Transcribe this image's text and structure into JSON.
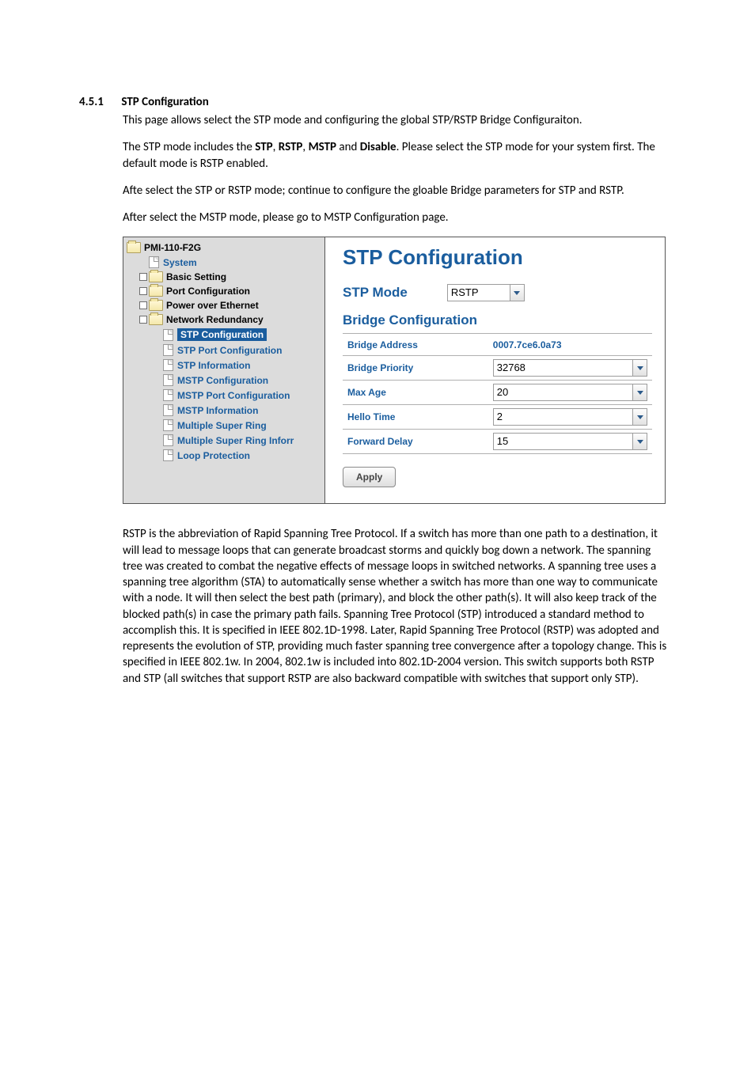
{
  "section": {
    "number": "4.5.1",
    "title": "STP Configuration"
  },
  "paragraphs": {
    "p1": "This page allows select the STP mode and configuring the global STP/RSTP Bridge Configuraiton.",
    "p2a": "The STP mode includes the ",
    "p2b": ", ",
    "p2c": ", ",
    "p2d": " and ",
    "p2e": ". Please select the STP mode for your system first. The default mode is RSTP enabled.",
    "p2_bold1": "STP",
    "p2_bold2": "RSTP",
    "p2_bold3": "MSTP",
    "p2_bold4": "Disable",
    "p3": "Afte select the STP or RSTP mode; continue to configure the gloable Bridge parameters for STP and RSTP.",
    "p4": "After select the MSTP mode, please go to MSTP Configuration page.",
    "p5": "RSTP is the abbreviation of Rapid Spanning Tree Protocol. If a switch has more than one path to a destination, it will lead to message loops that can generate broadcast storms and quickly bog down a network. The spanning tree was created to combat the negative effects of message loops in switched networks. A spanning tree uses a spanning tree algorithm (STA) to automatically sense whether a switch has more than one way to communicate with a node. It will then select the best path (primary), and block the other path(s). It will also keep track of the blocked path(s) in case the primary path fails. Spanning Tree Protocol (STP) introduced a standard method to accomplish this. It is specified in IEEE 802.1D-1998. Later, Rapid Spanning Tree Protocol (RSTP) was adopted and represents the evolution of STP, providing much faster spanning tree convergence after a topology change. This is specified in IEEE 802.1w. In 2004, 802.1w is included into 802.1D-2004 version. This switch supports both RSTP and STP (all switches that support RSTP are also backward compatible with switches that support only STP)."
  },
  "tree": {
    "root": "PMI-110-F2G",
    "system": "System",
    "basic_setting": "Basic Setting",
    "port_config": "Port Configuration",
    "power_over_ethernet": "Power over Ethernet",
    "network_redundancy": "Network Redundancy",
    "stp_configuration": "STP Configuration",
    "stp_port_configuration": "STP Port Configuration",
    "stp_information": "STP Information",
    "mstp_configuration": "MSTP Configuration",
    "mstp_port_configuration": "MSTP Port Configuration",
    "mstp_information": "MSTP Information",
    "multiple_super_ring": "Multiple Super Ring",
    "multiple_super_ring_inform": "Multiple Super Ring Inforr",
    "loop_protection": "Loop Protection"
  },
  "panel": {
    "title": "STP Configuration",
    "stp_mode_label": "STP Mode",
    "stp_mode_value": "RSTP",
    "bridge_config_label": "Bridge Configuration",
    "rows": {
      "bridge_address_label": "Bridge Address",
      "bridge_address_value": "0007.7ce6.0a73",
      "bridge_priority_label": "Bridge Priority",
      "bridge_priority_value": "32768",
      "max_age_label": "Max Age",
      "max_age_value": "20",
      "hello_time_label": "Hello Time",
      "hello_time_value": "2",
      "forward_delay_label": "Forward Delay",
      "forward_delay_value": "15"
    },
    "apply_label": "Apply"
  }
}
